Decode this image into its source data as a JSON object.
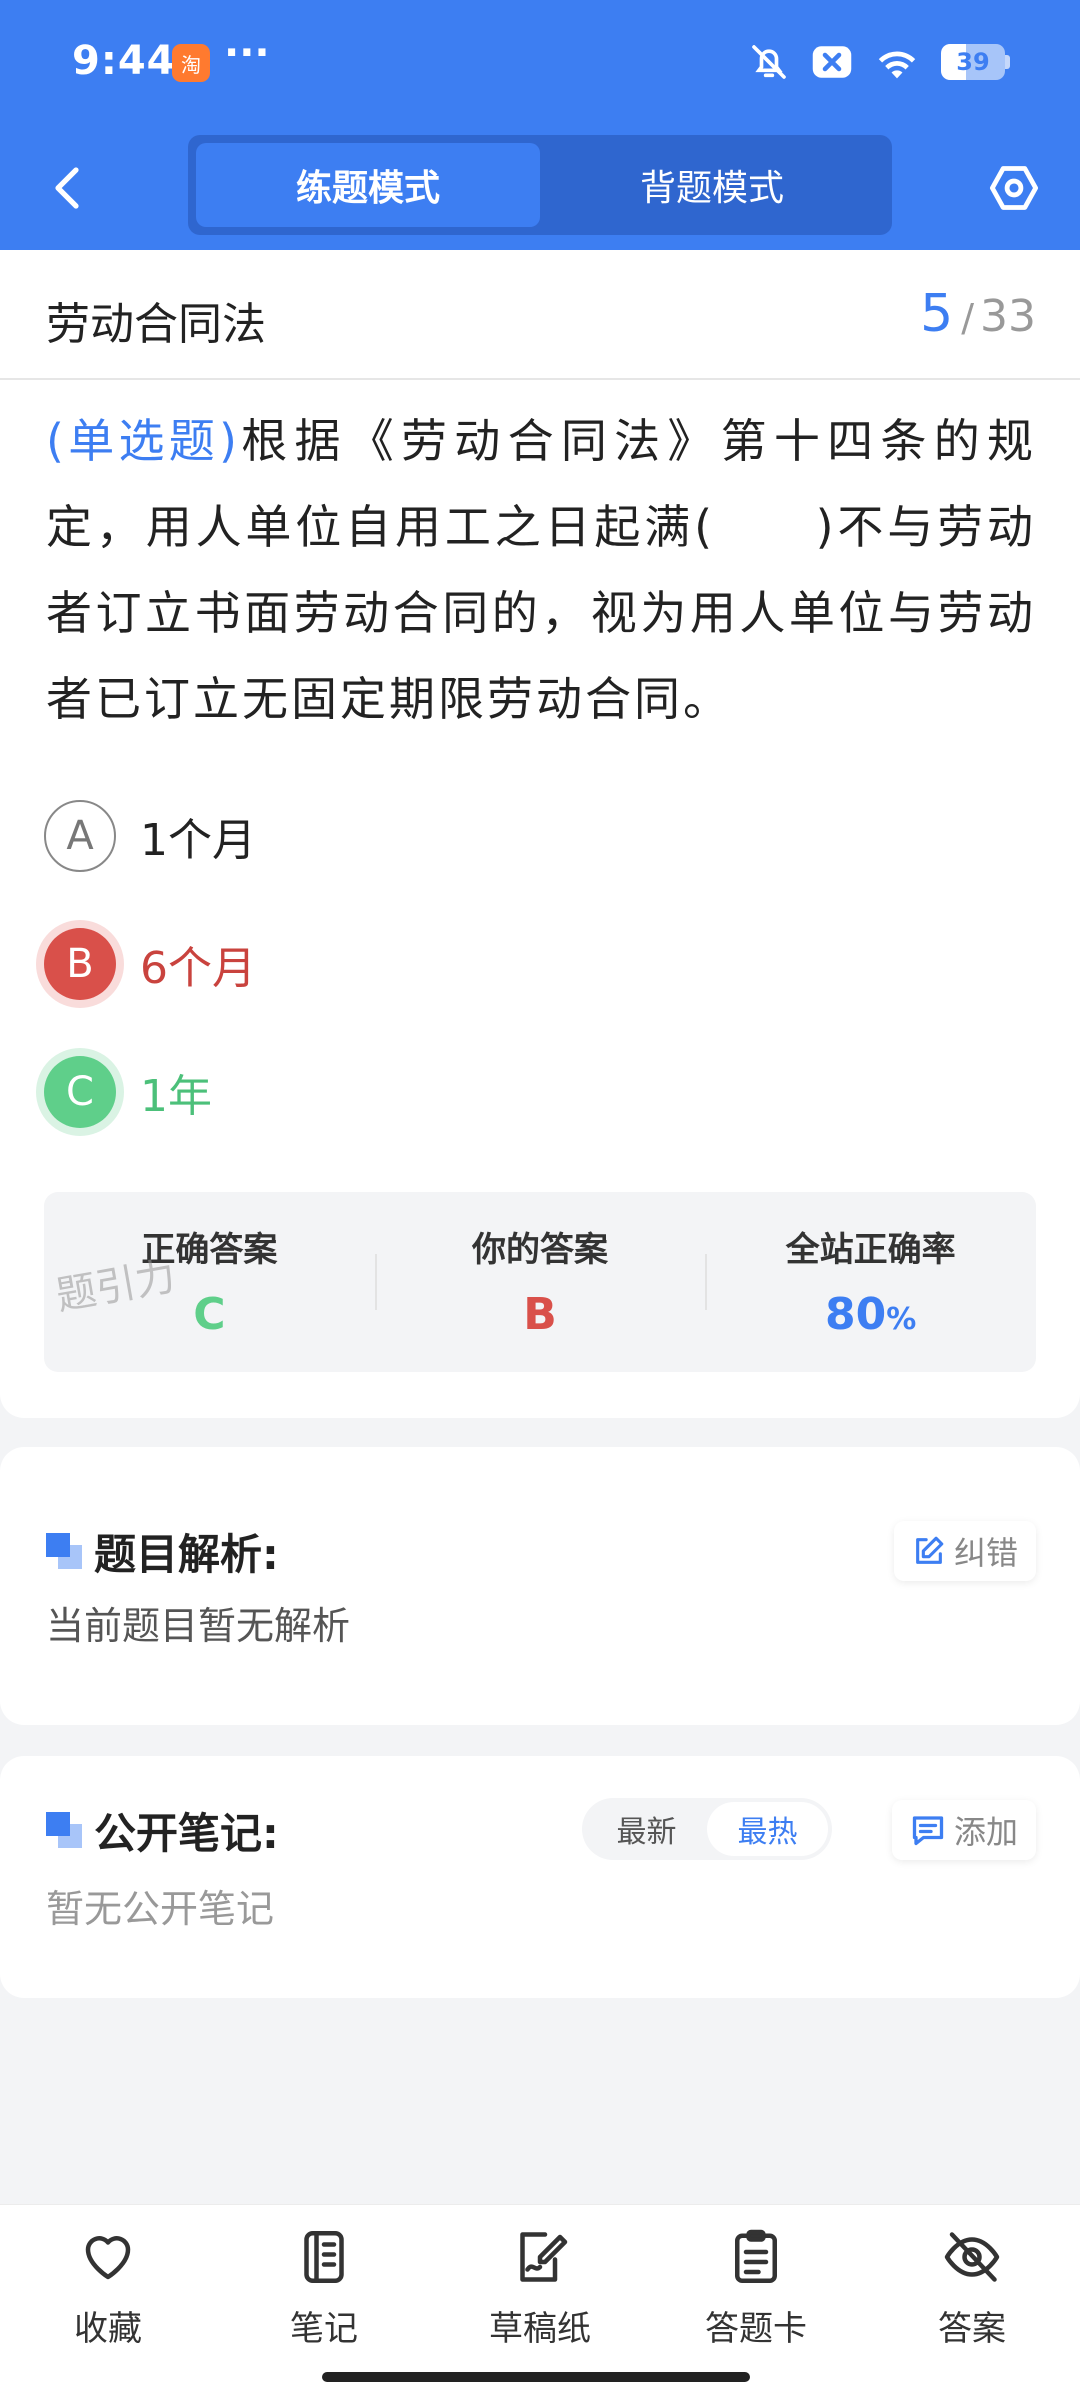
{
  "status_bar": {
    "time": "9:44",
    "app_icon": "taobao-app-icon",
    "more": "···",
    "battery_level": "39",
    "battery_fraction": 0.39,
    "icons": [
      "bell-off-icon",
      "close-badge-icon",
      "wifi-icon",
      "battery-icon"
    ]
  },
  "nav": {
    "tabs": [
      {
        "label": "练题模式",
        "active": true
      },
      {
        "label": "背题模式",
        "active": false
      }
    ],
    "icons": [
      "back-icon",
      "settings-icon"
    ]
  },
  "question": {
    "chapter": "劳动合同法",
    "current": "5",
    "separator": "/",
    "total": "33",
    "type": "(单选题)",
    "text": "根据《劳动合同法》第十四条的规定，用人单位自用工之日起满(　　)不与劳动者订立书面劳动合同的，视为用人单位与劳动者已订立无固定期限劳动合同。",
    "options": [
      {
        "letter": "A",
        "text": "1个月",
        "state": "neutral"
      },
      {
        "letter": "B",
        "text": "6个月",
        "state": "wrong"
      },
      {
        "letter": "C",
        "text": "1年",
        "state": "correct"
      }
    ]
  },
  "result": {
    "correct_label": "正确答案",
    "correct_value": "C",
    "mine_label": "你的答案",
    "mine_value": "B",
    "rate_label": "全站正确率",
    "rate_value": "80",
    "rate_unit": "%",
    "watermark": "题引力"
  },
  "analysis": {
    "title": "题目解析:",
    "button": "纠错",
    "empty": "当前题目暂无解析"
  },
  "notes": {
    "title": "公开笔记:",
    "sort_tabs": [
      {
        "label": "最新",
        "active": false
      },
      {
        "label": "最热",
        "active": true
      }
    ],
    "button": "添加",
    "empty": "暂无公开笔记"
  },
  "bottom_tabs": [
    {
      "label": "收藏",
      "icon": "heart-icon"
    },
    {
      "label": "笔记",
      "icon": "notebook-icon"
    },
    {
      "label": "草稿纸",
      "icon": "draft-pen-icon"
    },
    {
      "label": "答题卡",
      "icon": "clipboard-icon"
    },
    {
      "label": "答案",
      "icon": "eye-off-icon"
    }
  ],
  "colors": {
    "primary": "#3d7ef2",
    "wrong": "#d9504a",
    "correct": "#5fcf8a",
    "background": "#f3f4f6"
  }
}
